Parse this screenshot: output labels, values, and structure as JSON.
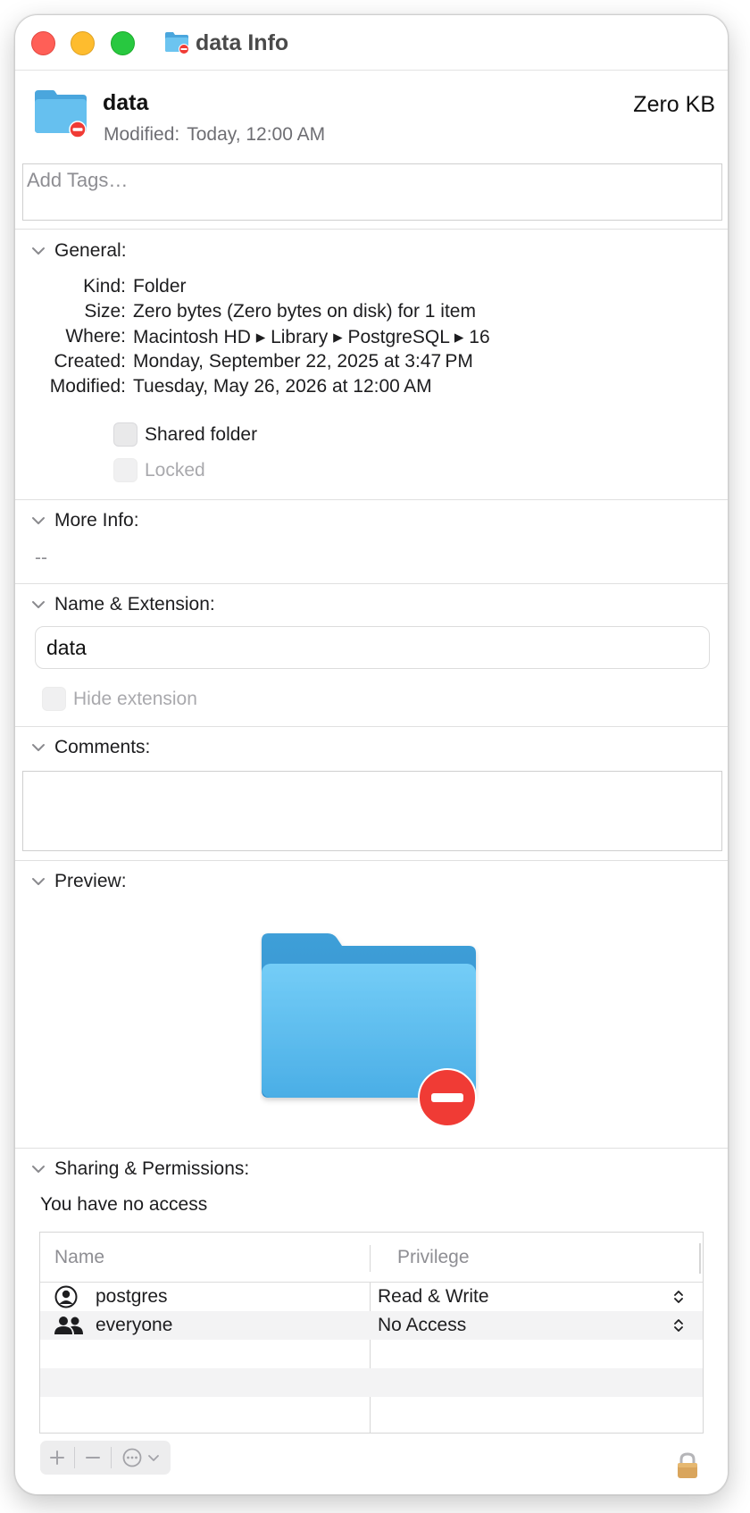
{
  "window": {
    "title": "data Info"
  },
  "header": {
    "name": "data",
    "size": "Zero KB",
    "modified_label": "Modified:",
    "modified_value": "Today, 12:00 AM"
  },
  "tags": {
    "placeholder": "Add Tags…"
  },
  "general": {
    "label": "General:",
    "rows": [
      {
        "key": "Kind:",
        "value": "Folder"
      },
      {
        "key": "Size:",
        "value": "Zero bytes (Zero bytes on disk) for 1 item"
      },
      {
        "key": "Where:",
        "value": "Macintosh HD ▸ Library ▸ PostgreSQL ▸ 16"
      },
      {
        "key": "Created:",
        "value": "Monday, September 22, 2025 at 3:47 PM"
      },
      {
        "key": "Modified:",
        "value": "Tuesday, May 26, 2026 at 12:00 AM"
      }
    ],
    "shared_folder": "Shared folder",
    "locked": "Locked"
  },
  "more_info": {
    "label": "More Info:",
    "value": "--"
  },
  "name_extension": {
    "label": "Name & Extension:",
    "value": "data",
    "hide_extension": "Hide extension"
  },
  "comments": {
    "label": "Comments:",
    "value": ""
  },
  "preview": {
    "label": "Preview:"
  },
  "sharing": {
    "label": "Sharing & Permissions:",
    "access_text": "You have no access",
    "col_name": "Name",
    "col_privilege": "Privilege",
    "rows": [
      {
        "name": "postgres",
        "privilege": "Read & Write",
        "icon": "user-icon"
      },
      {
        "name": "everyone",
        "privilege": "No Access",
        "icon": "group-icon"
      }
    ]
  },
  "colors": {
    "folder_blue": "#5ab6ea",
    "badge_red": "#f03b35"
  }
}
